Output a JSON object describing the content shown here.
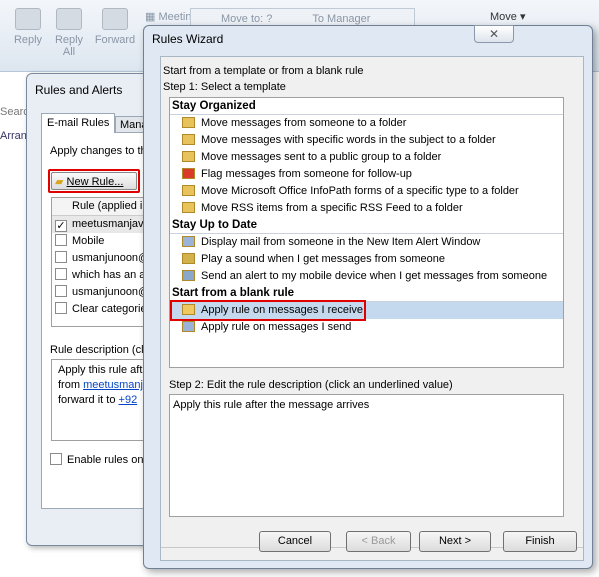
{
  "ribbon": {
    "reply": "Reply",
    "reply_all": "Reply All",
    "forward": "Forward",
    "meeting": "Meeting",
    "move_to": "Move to: ?",
    "to_manager": "To Manager",
    "move": "Move"
  },
  "left": {
    "search": "Searc",
    "arrange": "Arran"
  },
  "rules_alerts": {
    "title": "Rules and Alerts",
    "tab_email_rules": "E-mail Rules",
    "tab_manage": "Mana",
    "apply_changes": "Apply changes to th",
    "new_rule": "New Rule...",
    "col_rule": "Rule (applied in",
    "rules": [
      {
        "name": "meetusmanjav",
        "checked": true
      },
      {
        "name": "Mobile",
        "checked": false
      },
      {
        "name": "usmanjunoon@",
        "checked": false
      },
      {
        "name": "which has an a",
        "checked": false
      },
      {
        "name": "usmanjunoon@",
        "checked": false
      },
      {
        "name": "Clear categorie",
        "checked": false
      }
    ],
    "desc_label": "Rule description (cli",
    "desc_line1": "Apply this rule aft",
    "desc_line2_pre": "from ",
    "desc_line2_link": "meetusmanja",
    "desc_line3_pre": "forward it to ",
    "desc_line3_link": "+92",
    "enable_rules": "Enable rules on"
  },
  "wizard": {
    "title": "Rules Wizard",
    "close": "✕",
    "intro": "Start from a template or from a blank rule",
    "step1": "Step 1: Select a template",
    "groups": [
      {
        "name": "Stay Organized",
        "items": [
          "Move messages from someone to a folder",
          "Move messages with specific words in the subject to a folder",
          "Move messages sent to a public group to a folder",
          "Flag messages from someone for follow-up",
          "Move Microsoft Office InfoPath forms of a specific type to a folder",
          "Move RSS items from a specific RSS Feed to a folder"
        ]
      },
      {
        "name": "Stay Up to Date",
        "items": [
          "Display mail from someone in the New Item Alert Window",
          "Play a sound when I get messages from someone",
          "Send an alert to my mobile device when I get messages from someone"
        ]
      },
      {
        "name": "Start from a blank rule",
        "items": [
          "Apply rule on messages I receive",
          "Apply rule on messages I send"
        ]
      }
    ],
    "selected": "Apply rule on messages I receive",
    "step2": "Step 2: Edit the rule description (click an underlined value)",
    "description": "Apply this rule after the message arrives",
    "buttons": {
      "cancel": "Cancel",
      "back": "< Back",
      "next": "Next >",
      "finish": "Finish"
    },
    "highlight_color": "#e00000"
  }
}
